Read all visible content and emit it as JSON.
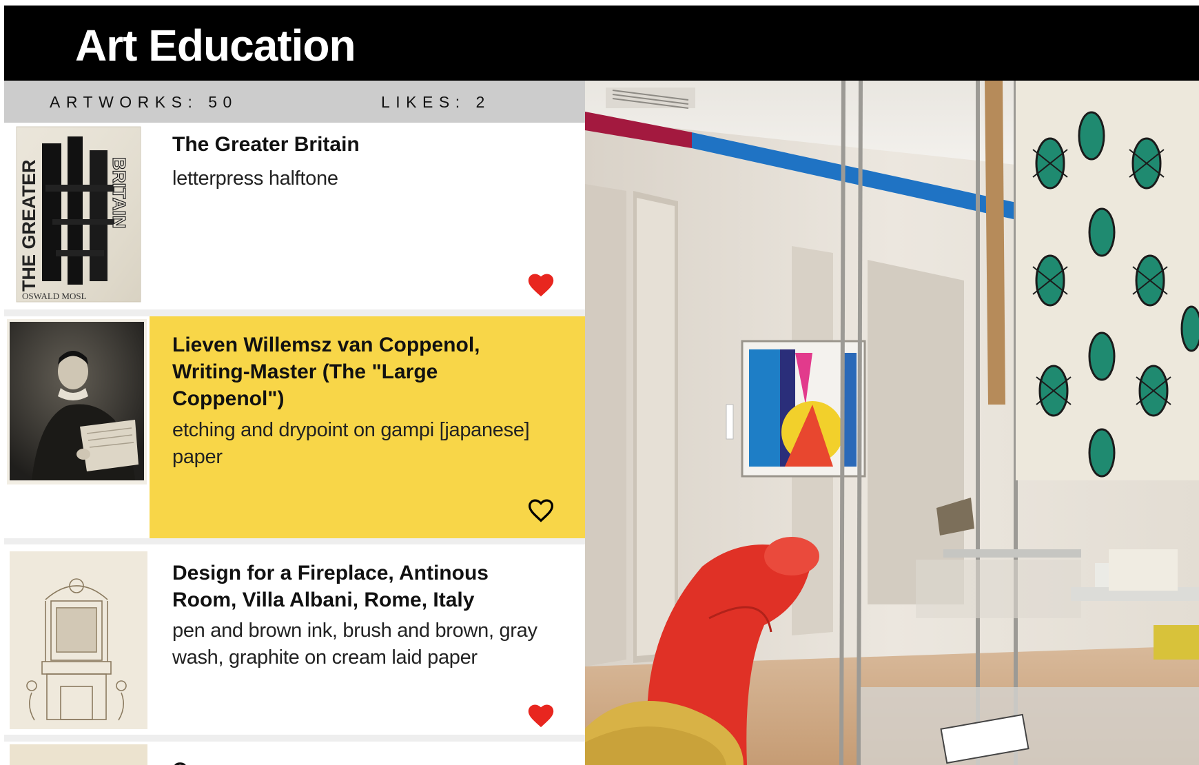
{
  "header": {
    "title": "Art Education"
  },
  "stats": {
    "artworks": "ARTWORKS: 50",
    "likes": "LIKES: 2"
  },
  "artworks": [
    {
      "title": "The Greater Britain",
      "medium": "letterpress halftone",
      "liked": true,
      "highlighted": false,
      "thumbnail_icon": "book-cover-thumbnail",
      "thumbnail_text": {
        "line1": "THE GREATER",
        "line2": "BRITAIN",
        "author": "OSWALD MOSL"
      }
    },
    {
      "title": "Lieven Willemsz van Coppenol, Writing-Master (The \"Large Coppenol\")",
      "medium": "etching and drypoint on gampi [japanese] paper",
      "liked": false,
      "highlighted": true,
      "thumbnail_icon": "etching-portrait-thumbnail"
    },
    {
      "title": "Design for a Fireplace, Antinous Room, Villa Albani, Rome, Italy",
      "medium": "pen and brown ink, brush and brown, gray wash, graphite on cream laid paper",
      "liked": true,
      "highlighted": false,
      "thumbnail_icon": "fireplace-drawing-thumbnail"
    },
    {
      "title": "Co...",
      "medium": "",
      "liked": false,
      "highlighted": false,
      "thumbnail_icon": "drawing-thumbnail"
    }
  ],
  "gallery": {
    "image_icon": "museum-gallery-photo"
  },
  "colors": {
    "header_bg": "#000000",
    "stats_bg": "#cccccc",
    "highlight": "#f8d648",
    "heart_liked": "#e8261f",
    "heart_unliked": "#000000"
  }
}
